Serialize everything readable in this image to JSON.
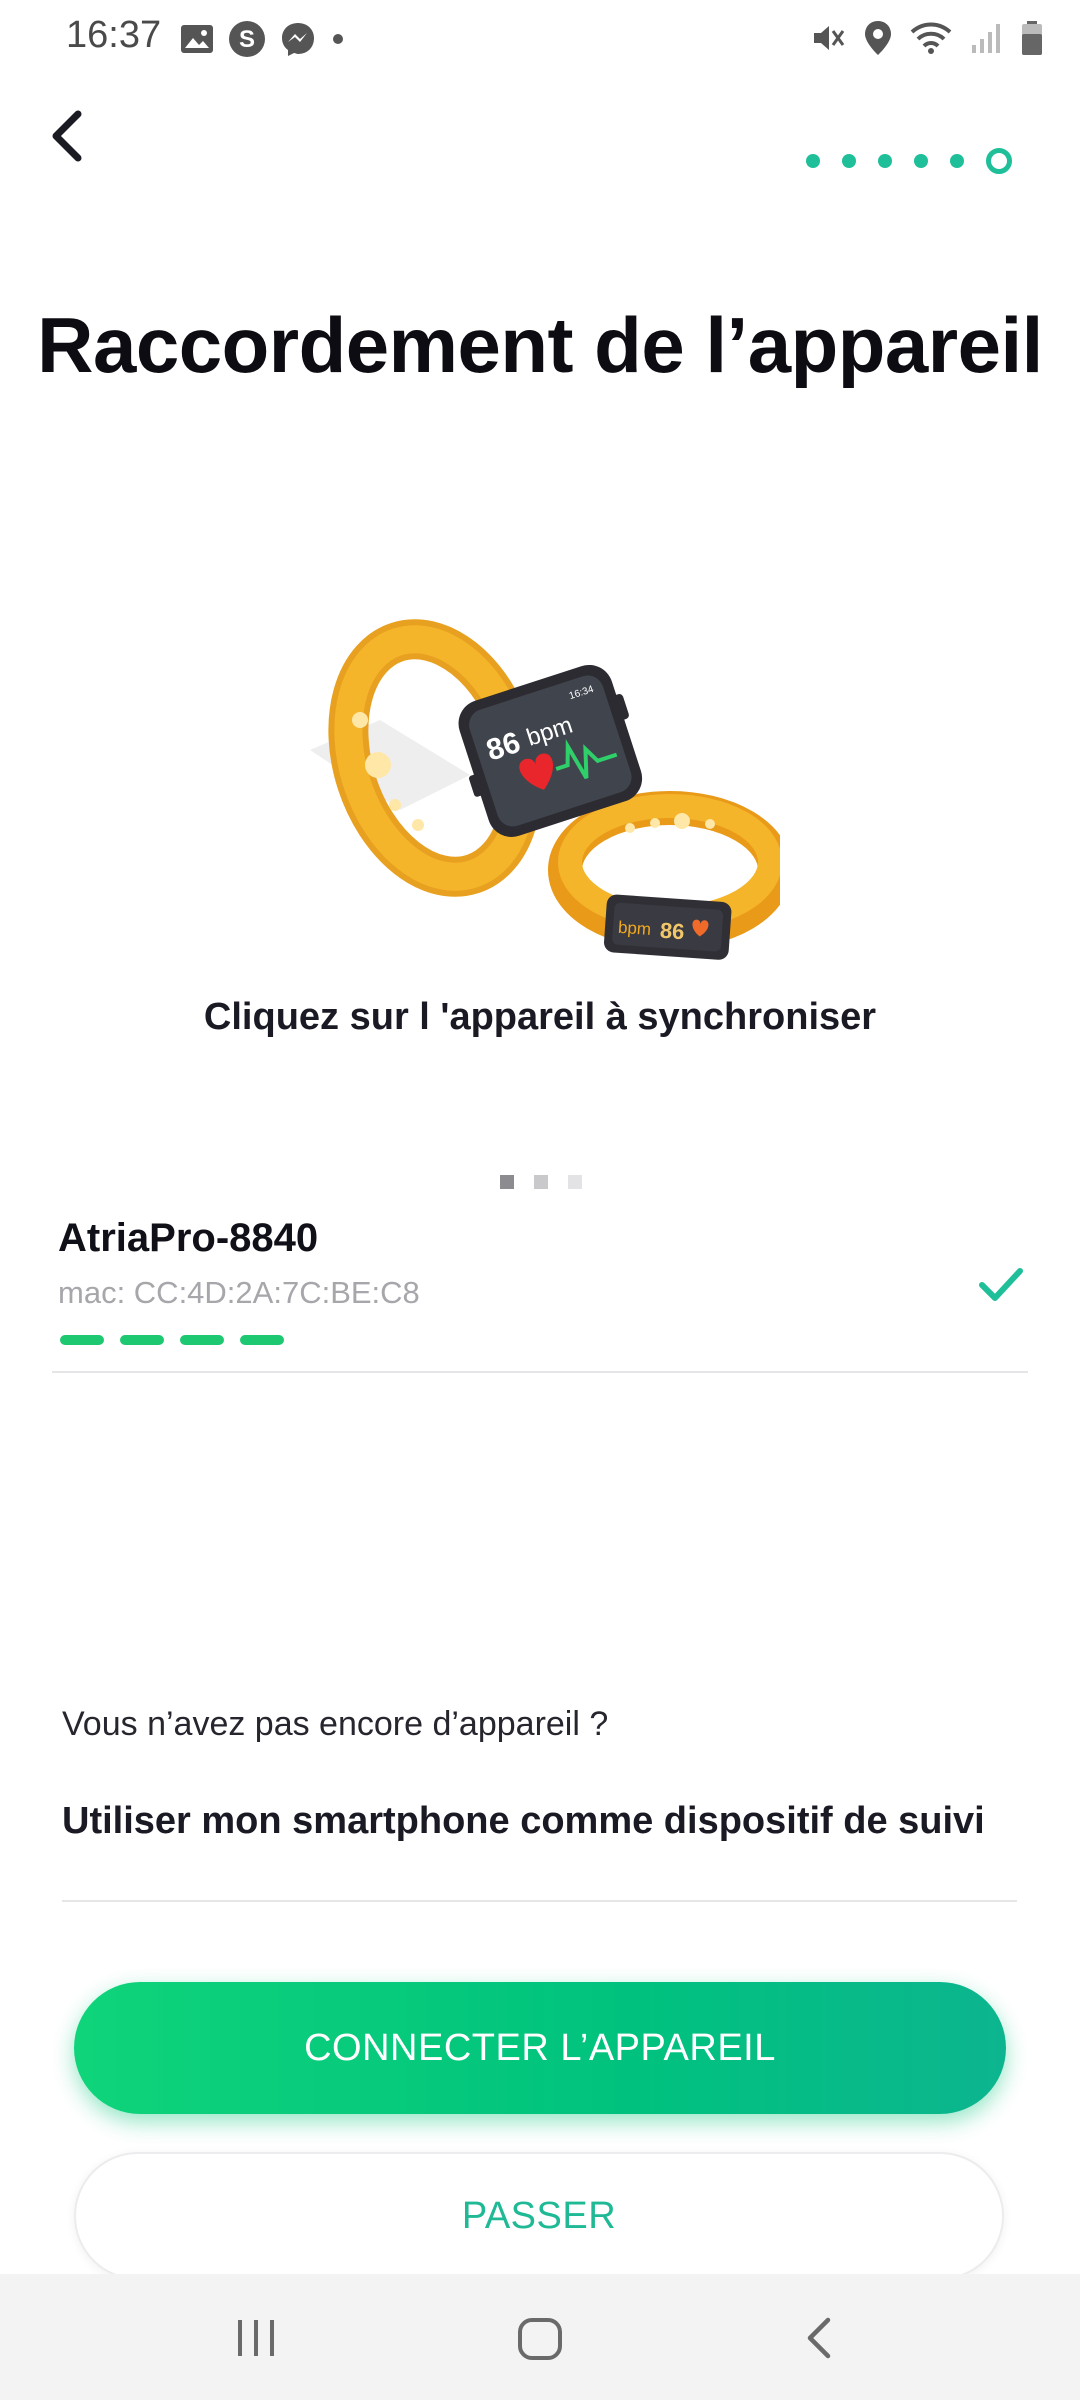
{
  "status_bar": {
    "time": "16:37",
    "left_icons": [
      "gallery-icon",
      "s-app-icon",
      "messenger-icon",
      "dot-icon"
    ],
    "right_icons": [
      "mute-icon",
      "location-icon",
      "wifi-icon",
      "signal-icon",
      "battery-icon"
    ]
  },
  "header": {
    "back_icon": "chevron-left-icon",
    "steps_total": 6,
    "step_current": 6
  },
  "title": "Raccordement de l’appareil",
  "illustration": {
    "watch_bpm": "86 bpm",
    "watch_time": "16:34",
    "band_value": "86",
    "band_unit": "bpm"
  },
  "instruction": "Cliquez sur l 'appareil à synchroniser",
  "carousel": {
    "count": 3,
    "active": 0
  },
  "device": {
    "name": "AtriaPro-8840",
    "mac": "mac: CC:4D:2A:7C:BE:C8",
    "progress_segments": 4,
    "status_icon": "check-icon"
  },
  "no_device_prompt": "Vous n’avez pas encore d’appareil ?",
  "smartphone_option": "Utiliser mon smartphone comme dispositif de suivi",
  "buttons": {
    "connect": "CONNECTER L’APPAREIL",
    "skip": "PASSER"
  },
  "colors": {
    "accent": "#1fbf9a",
    "button_gradient_start": "#0fd47a",
    "button_gradient_end": "#0cb58f",
    "progress": "#1dc870",
    "band": "#f2a91f"
  },
  "nav_bar": [
    "recent-apps-icon",
    "home-icon",
    "back-icon"
  ]
}
